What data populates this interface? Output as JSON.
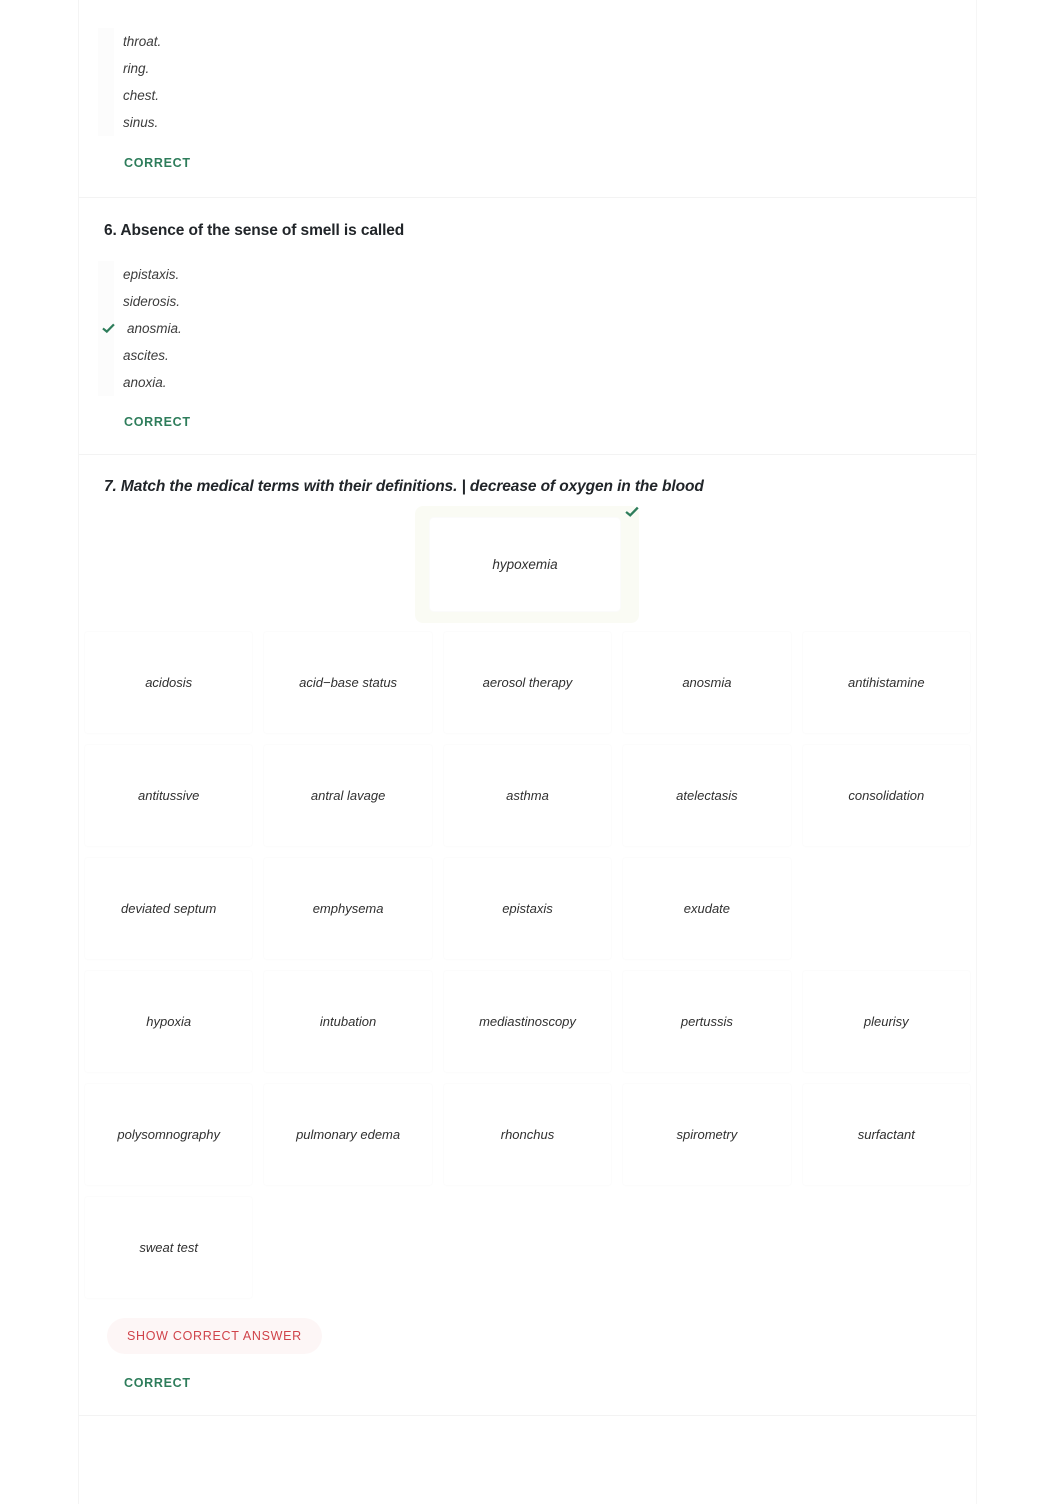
{
  "colors": {
    "correct_green": "#2e7d5b",
    "show_answer_red": "#d0434a",
    "text": "#303030",
    "heading": "#212529",
    "selected_halo": "#fafbf4"
  },
  "questions": [
    {
      "id": "q5-partial",
      "title": null,
      "choices": [
        {
          "text": "throat.",
          "selected": false
        },
        {
          "text": "ring.",
          "selected": false
        },
        {
          "text": "chest.",
          "selected": false
        },
        {
          "text": "sinus.",
          "selected": false
        }
      ],
      "status": "CORRECT"
    },
    {
      "id": "q6",
      "title": "6. Absence of the sense of smell is called",
      "choices": [
        {
          "text": "epistaxis.",
          "selected": false
        },
        {
          "text": "siderosis.",
          "selected": false
        },
        {
          "text": "anosmia.",
          "selected": true
        },
        {
          "text": "ascites.",
          "selected": false
        },
        {
          "text": "anoxia.",
          "selected": false
        }
      ],
      "status": "CORRECT"
    }
  ],
  "matching": {
    "title": "7. Match the medical terms with their definitions. | decrease of oxygen in the blood",
    "selected_answer": "hypoxemia",
    "selected_is_correct": true,
    "show_answer_label": "SHOW CORRECT ANSWER",
    "status": "CORRECT",
    "options": [
      "acidosis",
      "acid−base status",
      "aerosol therapy",
      "anosmia",
      "antihistamine",
      "antitussive",
      "antral lavage",
      "asthma",
      "atelectasis",
      "consolidation",
      "deviated septum",
      "emphysema",
      "epistaxis",
      "exudate",
      "",
      "hypoxia",
      "intubation",
      "mediastinoscopy",
      "pertussis",
      "pleurisy",
      "polysomnography",
      "pulmonary edema",
      "rhonchus",
      "spirometry",
      "surfactant",
      "sweat test",
      "",
      "",
      "",
      ""
    ]
  }
}
